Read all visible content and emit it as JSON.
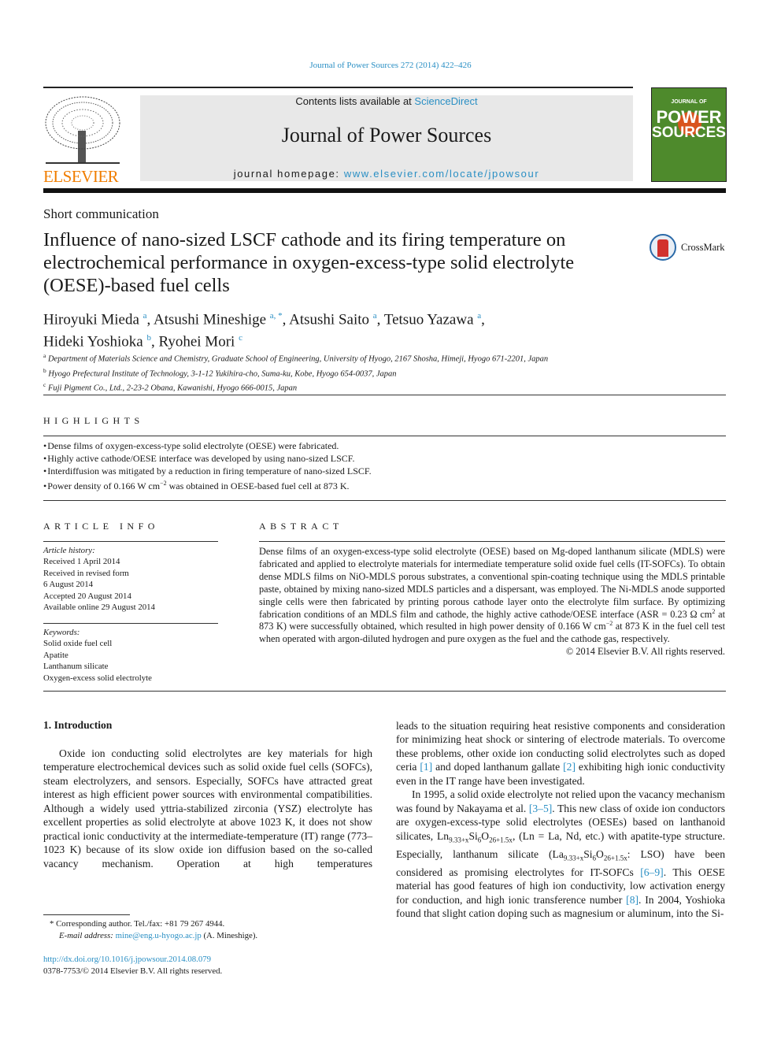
{
  "header": {
    "citation": "Journal of Power Sources 272 (2014) 422–426",
    "contents_prefix": "Contents lists available at ",
    "contents_link": "ScienceDirect",
    "journal_title": "Journal of Power Sources",
    "homepage_prefix": "journal homepage: ",
    "homepage_link": "www.elsevier.com/locate/jpowsour",
    "publisher_logo_text": "ELSEVIER",
    "cover_text": [
      "JOURNAL OF",
      "POWER",
      "SOURCES"
    ],
    "accent_color": "#2a8fc4",
    "publisher_color": "#f07d00",
    "cover_color": "#4e8a2c"
  },
  "article": {
    "type": "Short communication",
    "title": "Influence of nano-sized LSCF cathode and its firing temperature on electrochemical performance in oxygen-excess-type solid electrolyte (OESE)-based fuel cells",
    "crossmark": "CrossMark",
    "authors": [
      {
        "name": "Hiroyuki Mieda",
        "sup": "a",
        "sep": ", "
      },
      {
        "name": "Atsushi Mineshige",
        "sup": "a, *",
        "sep": ", "
      },
      {
        "name": "Atsushi Saito",
        "sup": "a",
        "sep": ", "
      },
      {
        "name": "Tetsuo Yazawa",
        "sup": "a",
        "sep": ","
      },
      {
        "name": "Hideki Yoshioka",
        "sup": "b",
        "sep": ", "
      },
      {
        "name": "Ryohei Mori",
        "sup": "c",
        "sep": ""
      }
    ],
    "affiliations": [
      {
        "key": "a",
        "text": "Department of Materials Science and Chemistry, Graduate School of Engineering, University of Hyogo, 2167 Shosha, Himeji, Hyogo 671-2201, Japan"
      },
      {
        "key": "b",
        "text": "Hyogo Prefectural Institute of Technology, 3-1-12 Yukihira-cho, Suma-ku, Kobe, Hyogo 654-0037, Japan"
      },
      {
        "key": "c",
        "text": "Fuji Pigment Co., Ltd., 2-23-2 Obana, Kawanishi, Hyogo 666-0015, Japan"
      }
    ]
  },
  "highlights": {
    "heading": "HIGHLIGHTS",
    "items": [
      "Dense films of oxygen-excess-type solid electrolyte (OESE) were fabricated.",
      "Highly active cathode/OESE interface was developed by using nano-sized LSCF.",
      "Interdiffusion was mitigated by a reduction in firing temperature of nano-sized LSCF."
    ],
    "item4_a": "Power density of 0.166 W cm",
    "item4_sup": "−2",
    "item4_b": " was obtained in OESE-based fuel cell at 873 K."
  },
  "article_info": {
    "heading": "ARTICLE INFO",
    "history_label": "Article history:",
    "history": [
      "Received 1 April 2014",
      "Received in revised form",
      "6 August 2014",
      "Accepted 20 August 2014",
      "Available online 29 August 2014"
    ],
    "keywords_label": "Keywords:",
    "keywords": [
      "Solid oxide fuel cell",
      "Apatite",
      "Lanthanum silicate",
      "Oxygen-excess solid electrolyte"
    ]
  },
  "abstract": {
    "heading": "ABSTRACT",
    "text_a": "Dense films of an oxygen-excess-type solid electrolyte (OESE) based on Mg-doped lanthanum silicate (MDLS) were fabricated and applied to electrolyte materials for intermediate temperature solid oxide fuel cells (IT-SOFCs). To obtain dense MDLS films on NiO-MDLS porous substrates, a conventional spin-coating technique using the MDLS printable paste, obtained by mixing nano-sized MDLS particles and a dispersant, was employed. The Ni-MDLS anode supported single cells were then fabricated by printing porous cathode layer onto the electrolyte film surface. By optimizing fabrication conditions of an MDLS film and cathode, the highly active cathode/OESE interface (ASR = 0.23 Ω cm",
    "sup_a": "2",
    "text_b": " at 873 K) were successfully obtained, which resulted in high power density of 0.166 W cm",
    "sup_b": "−2",
    "text_c": " at 873 K in the fuel cell test when operated with argon-diluted hydrogen and pure oxygen as the fuel and the cathode gas, respectively.",
    "copyright": "© 2014 Elsevier B.V. All rights reserved."
  },
  "body": {
    "section_heading": "1.  Introduction",
    "left_p1": "Oxide ion conducting solid electrolytes are key materials for high temperature electrochemical devices such as solid oxide fuel cells (SOFCs), steam electrolyzers, and sensors. Especially, SOFCs have attracted great interest as high efficient power sources with environmental compatibilities. Although a widely used yttria-stabilized zirconia (YSZ) electrolyte has excellent properties as solid electrolyte at above 1023 K, it does not show practical ionic conductivity at the intermediate-temperature (IT) range (773–1023 K) because of its slow oxide ion diffusion based on the so-called vacancy mechanism. Operation at high temperatures",
    "right_p1": {
      "a": "leads to the situation requiring heat resistive components and consideration for minimizing heat shock or sintering of electrode materials. To overcome these problems, other oxide ion conducting solid electrolytes such as doped ceria ",
      "ref1": "[1]",
      "b": " and doped lanthanum gallate ",
      "ref2": "[2]",
      "c": " exhibiting high ionic conductivity even in the IT range have been investigated."
    },
    "right_p2": {
      "a": "In 1995, a solid oxide electrolyte not relied upon the vacancy mechanism was found by Nakayama et al. ",
      "ref1": "[3–5]",
      "b": ". This new class of oxide ion conductors are oxygen-excess-type solid electrolytes (OESEs) based on lanthanoid silicates, Ln",
      "sub1": "9.33+x",
      "c": "Si",
      "sub2": "6",
      "d": "O",
      "sub3": "26+1.5x",
      "e": ", (Ln = La, Nd, etc.) with apatite-type structure. Especially, lanthanum silicate (La",
      "sub4": "9.33+x",
      "f": "Si",
      "sub5": "6",
      "g": "O",
      "sub6": "26+1.5x",
      "h": ": LSO) have been considered as promising electrolytes for IT-SOFCs ",
      "ref2": "[6–9]",
      "i": ". This OESE material has good features of high ion conductivity, low activation energy for conduction, and high ionic transference number ",
      "ref3": "[8]",
      "j": ". In 2004, Yoshioka found that slight cation doping such as magnesium or aluminum, into the Si-"
    }
  },
  "footnote": {
    "marker": "*",
    "corresponding": " Corresponding author. Tel./fax: +81 79 267 4944.",
    "email_label": "E-mail address: ",
    "email": "mine@eng.u-hyogo.ac.jp",
    "email_suffix": " (A. Mineshige)."
  },
  "doi": {
    "link": "http://dx.doi.org/10.1016/j.jpowsour.2014.08.079",
    "issn_line": "0378-7753/© 2014 Elsevier B.V. All rights reserved."
  }
}
